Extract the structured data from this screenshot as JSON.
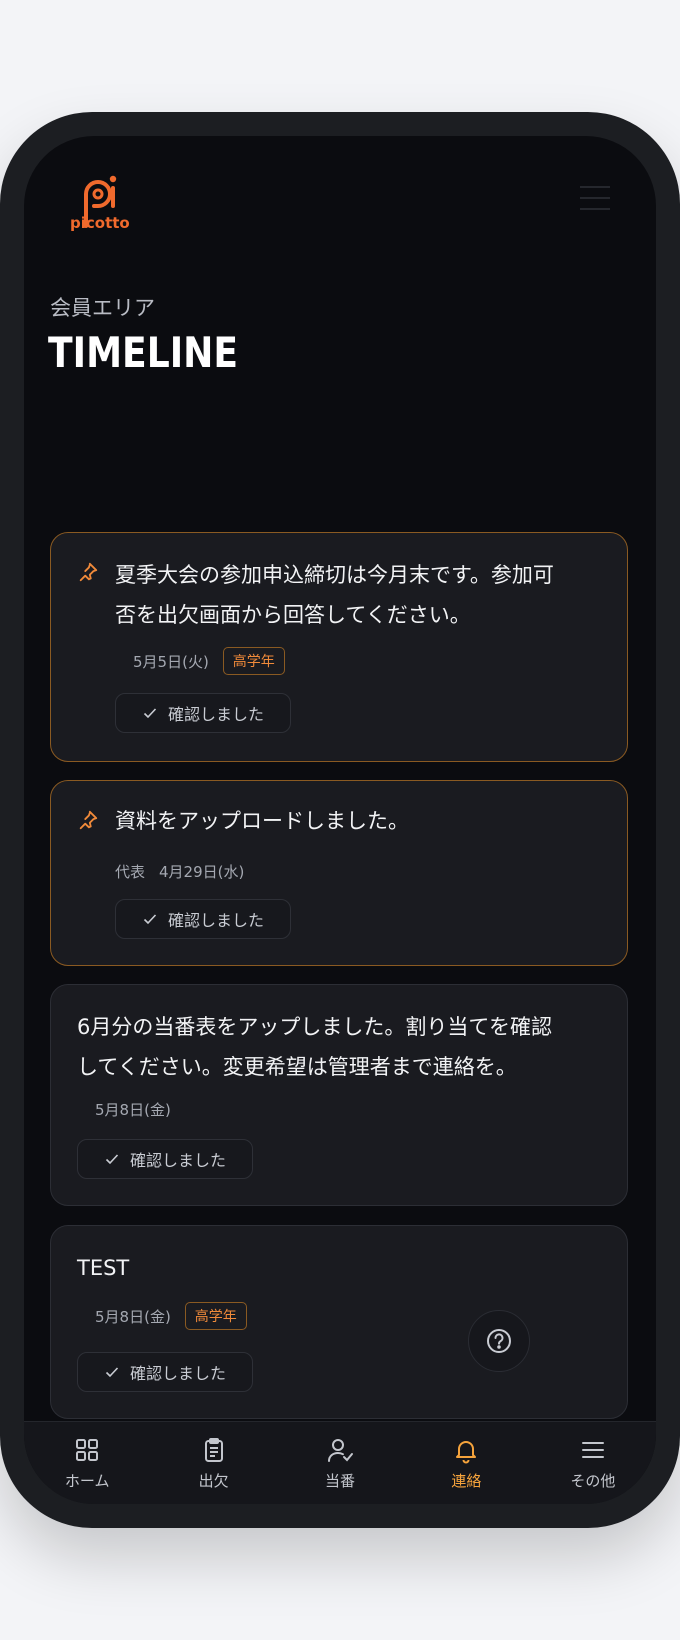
{
  "brand": {
    "name": "picotto",
    "color": "#f06a2d"
  },
  "header": {
    "subtitle": "会員エリア",
    "title": "TIMELINE",
    "menu_icon": "menu-icon"
  },
  "posts": [
    {
      "pinned": true,
      "text_lines": [
        "夏季大会の参加申込締切は今月末です。参加可",
        "否を出欠画面から回答してください。"
      ],
      "author": "",
      "date": "5月5日(火)",
      "badge": "高学年",
      "confirm_label": "確認しました"
    },
    {
      "pinned": true,
      "text_lines": [
        "資料をアップロードしました。"
      ],
      "author": "代表",
      "date": "4月29日(水)",
      "badge": "",
      "confirm_label": "確認しました"
    },
    {
      "pinned": false,
      "text_lines": [
        "6月分の当番表をアップしました。割り当てを確認",
        "してください。変更希望は管理者まで連絡を。"
      ],
      "author": "",
      "date": "5月8日(金)",
      "badge": "",
      "confirm_label": "確認しました"
    },
    {
      "pinned": false,
      "text_lines": [
        "TEST"
      ],
      "author": "",
      "date": "5月8日(金)",
      "badge": "高学年",
      "confirm_label": "確認しました"
    }
  ],
  "nav": {
    "items": [
      {
        "label": "ホーム",
        "icon": "home-grid-icon",
        "active": false
      },
      {
        "label": "出欠",
        "icon": "clipboard-icon",
        "active": false
      },
      {
        "label": "当番",
        "icon": "user-check-icon",
        "active": false
      },
      {
        "label": "連絡",
        "icon": "bell-icon",
        "active": true
      },
      {
        "label": "その他",
        "icon": "menu-icon",
        "active": false
      }
    ],
    "active_color": "#f5a33c"
  },
  "help_icon": "help-icon"
}
